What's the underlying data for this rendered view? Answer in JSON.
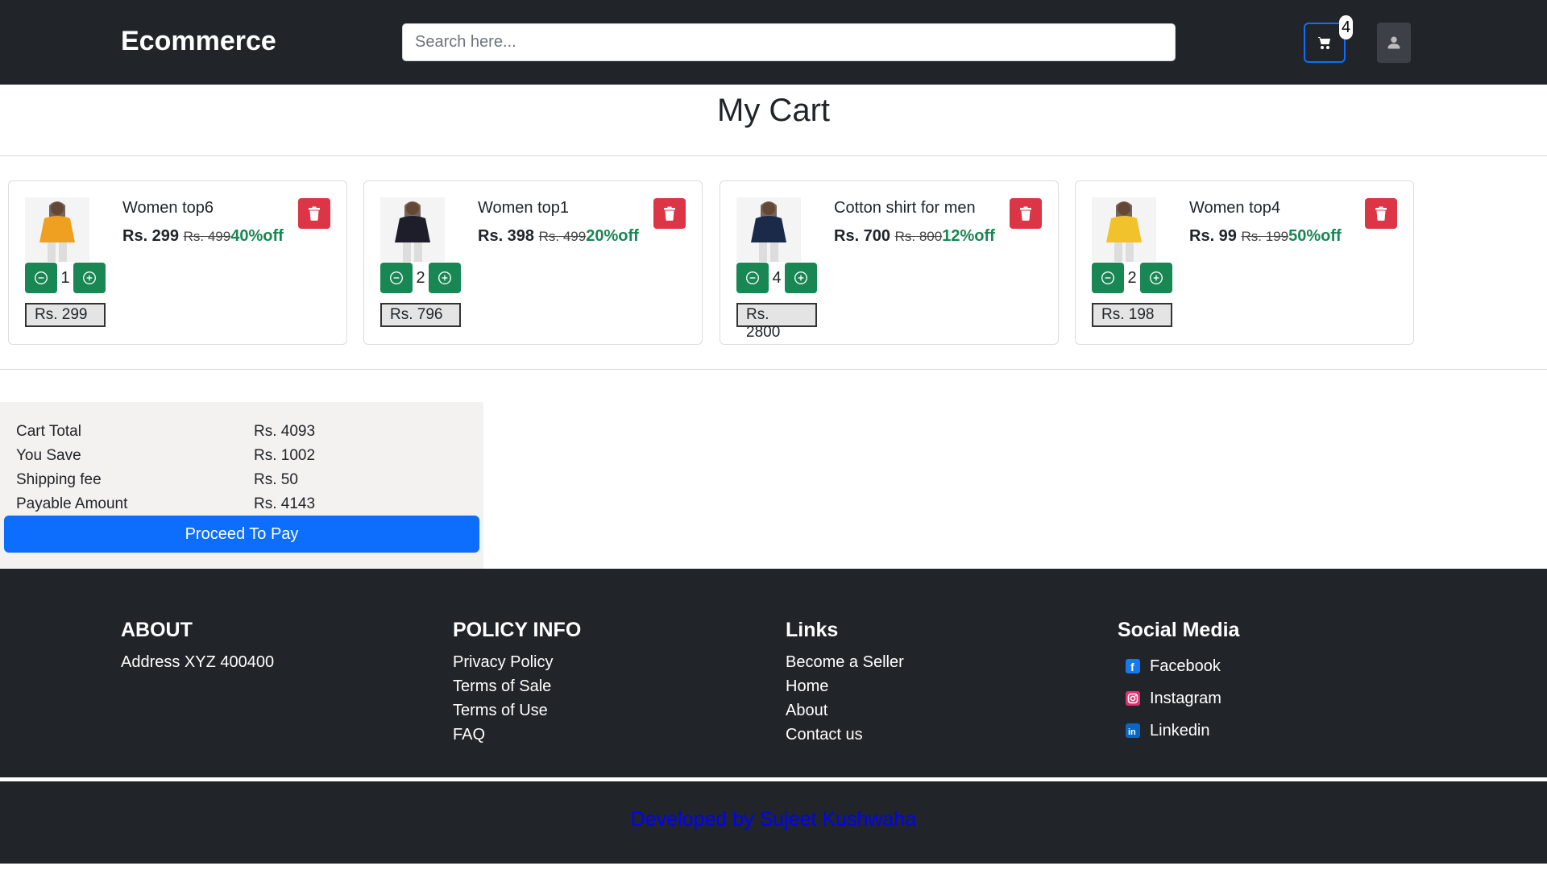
{
  "nav": {
    "brand": "Ecommerce",
    "search_placeholder": "Search here...",
    "cart_count": "4"
  },
  "page_title": "My Cart",
  "cart_items": [
    {
      "name": "Women top6",
      "price": "Rs. 299",
      "old_price": "Rs. 499",
      "discount": "40%off",
      "qty": "1",
      "line_total": "Rs. 299",
      "image": "woman-yellow-top",
      "image_color": "#f0a020"
    },
    {
      "name": "Women top1",
      "price": "Rs. 398",
      "old_price": "Rs. 499",
      "discount": "20%off",
      "qty": "2",
      "line_total": "Rs. 796",
      "image": "woman-black-top",
      "image_color": "#1e1e2a"
    },
    {
      "name": "Cotton shirt for men",
      "price": "Rs. 700",
      "old_price": "Rs. 800",
      "discount": "12%off",
      "qty": "4",
      "line_total": "Rs. 2800",
      "image": "man-navy-shirt",
      "image_color": "#1c2a4a"
    },
    {
      "name": "Women top4",
      "price": "Rs. 99",
      "old_price": "Rs. 199",
      "discount": "50%off",
      "qty": "2",
      "line_total": "Rs. 198",
      "image": "woman-floral-top",
      "image_color": "#f2c22c"
    }
  ],
  "summary": {
    "cart_total_label": "Cart Total",
    "cart_total": "Rs. 4093",
    "you_save_label": "You Save",
    "you_save": "Rs. 1002",
    "shipping_label": "Shipping fee",
    "shipping": "Rs. 50",
    "payable_label": "Payable Amount",
    "payable": "Rs. 4143",
    "pay_button": "Proceed To Pay"
  },
  "footer": {
    "about": {
      "heading": "ABOUT",
      "address": "Address XYZ 400400"
    },
    "policy": {
      "heading": "POLICY INFO",
      "links": [
        "Privacy Policy",
        "Terms of Sale",
        "Terms of Use",
        "FAQ"
      ]
    },
    "links": {
      "heading": "Links",
      "links": [
        "Become a Seller",
        "Home",
        "About",
        "Contact us"
      ]
    },
    "social": {
      "heading": "Social Media",
      "items": [
        {
          "label": "Facebook",
          "icon": "facebook-icon"
        },
        {
          "label": "Instagram",
          "icon": "instagram-icon"
        },
        {
          "label": "Linkedin",
          "icon": "linkedin-icon"
        }
      ]
    },
    "credit": "Developed by Sujeet Kushwaha"
  },
  "colors": {
    "nav_bg": "#212529",
    "primary": "#0d6efd",
    "success": "#198754",
    "danger": "#dc3545",
    "credit": "#0000ff"
  }
}
